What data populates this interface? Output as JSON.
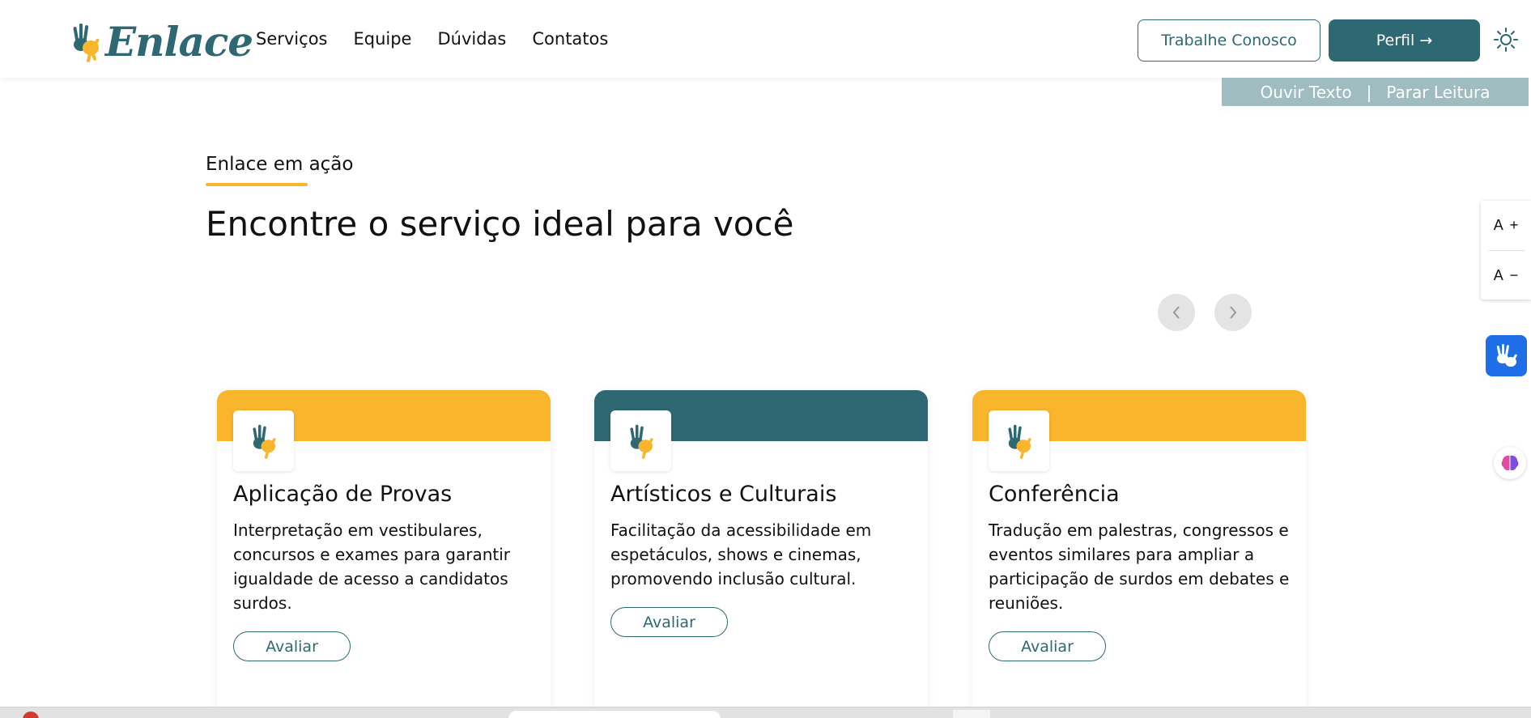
{
  "header": {
    "logo_text": "Enlace",
    "nav": [
      "Serviços",
      "Equipe",
      "Dúvidas",
      "Contatos"
    ],
    "work_button": "Trabalhe Conosco",
    "profile_button": "Perfil →"
  },
  "tts": {
    "listen": "Ouvir Texto",
    "separator": "|",
    "stop": "Parar Leitura"
  },
  "section": {
    "eyebrow": "Enlace em ação",
    "title": "Encontre o serviço ideal para você"
  },
  "font_controls": {
    "increase": "A",
    "increase_sign": "+",
    "decrease": "A",
    "decrease_sign": "−"
  },
  "cards": [
    {
      "title": "Aplicação de Provas",
      "description": "Interpretação em vestibulares, concursos e exames para garantir igualdade de acesso a candidatos surdos.",
      "button": "Avaliar",
      "band_color": "#f9b52c"
    },
    {
      "title": "Artísticos e Culturais",
      "description": "Facilitação da acessibilidade em espetáculos, shows e cinemas, promovendo inclusão cultural.",
      "button": "Avaliar",
      "band_color": "#2e6872"
    },
    {
      "title": "Conferência",
      "description": "Tradução em palestras, congressos e eventos similares para ampliar a participação de surdos em debates e reuniões.",
      "button": "Avaliar",
      "band_color": "#f9b52c"
    }
  ],
  "colors": {
    "primary": "#2e6872",
    "accent": "#f9b52c",
    "tts_bg": "#9fbcc1",
    "vlibras": "#1e6ee8"
  },
  "icons": [
    "hands-logo-icon",
    "sun-icon",
    "chevron-left-icon",
    "chevron-right-icon",
    "sign-language-icon",
    "brain-icon"
  ]
}
